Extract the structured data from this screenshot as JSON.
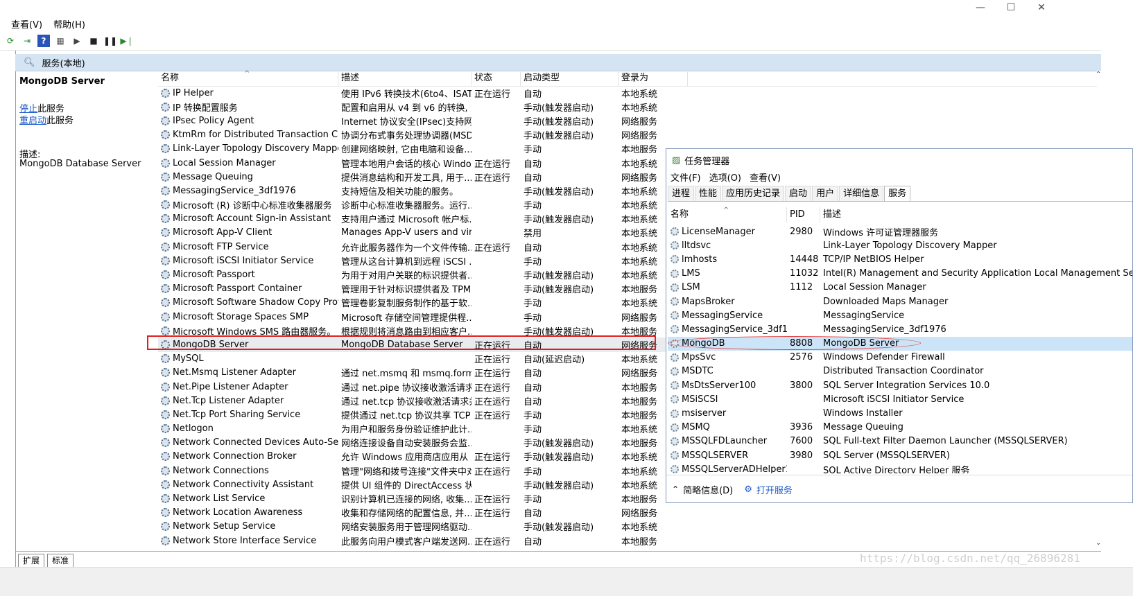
{
  "menu": {
    "view": "查看(V)",
    "help": "帮助(H)"
  },
  "window_controls": {
    "minimize": "—",
    "maximize": "☐",
    "close": "✕"
  },
  "panel": {
    "title": "服务(本地)"
  },
  "detail": {
    "service_name": "MongoDB Server",
    "stop_link": "停止",
    "stop_suffix": "此服务",
    "restart_link": "重启动",
    "restart_suffix": "此服务",
    "desc_label": "描述:",
    "desc_text": "MongoDB Database Server"
  },
  "columns": {
    "name": "名称",
    "description": "描述",
    "status": "状态",
    "startup": "启动类型",
    "logon": "登录为"
  },
  "services": [
    {
      "name": "IP Helper",
      "desc": "使用 IPv6 转换技术(6to4、ISAT...",
      "status": "正在运行",
      "startup": "自动",
      "logon": "本地系统"
    },
    {
      "name": "IP 转换配置服务",
      "desc": "配置和启用从 v4 到 v6 的转换, ...",
      "status": "",
      "startup": "手动(触发器启动)",
      "logon": "本地系统"
    },
    {
      "name": "IPsec Policy Agent",
      "desc": "Internet 协议安全(IPsec)支持网...",
      "status": "",
      "startup": "手动(触发器启动)",
      "logon": "网络服务"
    },
    {
      "name": "KtmRm for Distributed Transaction Coor...",
      "desc": "协调分布式事务处理协调器(MSD...",
      "status": "",
      "startup": "手动(触发器启动)",
      "logon": "网络服务"
    },
    {
      "name": "Link-Layer Topology Discovery Mapper",
      "desc": "创建网络映射, 它由电脑和设备...",
      "status": "",
      "startup": "手动",
      "logon": "本地服务"
    },
    {
      "name": "Local Session Manager",
      "desc": "管理本地用户会话的核心 Windo...",
      "status": "正在运行",
      "startup": "自动",
      "logon": "本地系统"
    },
    {
      "name": "Message Queuing",
      "desc": "提供消息结构和开发工具, 用于...",
      "status": "正在运行",
      "startup": "自动",
      "logon": "网络服务"
    },
    {
      "name": "MessagingService_3df1976",
      "desc": "支持短信及相关功能的服务。",
      "status": "",
      "startup": "手动(触发器启动)",
      "logon": "本地系统"
    },
    {
      "name": "Microsoft (R) 诊断中心标准收集器服务",
      "desc": "诊断中心标准收集器服务。运行...",
      "status": "",
      "startup": "手动",
      "logon": "本地系统"
    },
    {
      "name": "Microsoft Account Sign-in Assistant",
      "desc": "支持用户通过 Microsoft 帐户标...",
      "status": "",
      "startup": "手动(触发器启动)",
      "logon": "本地系统"
    },
    {
      "name": "Microsoft App-V Client",
      "desc": "Manages App-V users and virt...",
      "status": "",
      "startup": "禁用",
      "logon": "本地系统"
    },
    {
      "name": "Microsoft FTP Service",
      "desc": "允许此服务器作为一个文件传输...",
      "status": "正在运行",
      "startup": "自动",
      "logon": "本地系统"
    },
    {
      "name": "Microsoft iSCSI Initiator Service",
      "desc": "管理从这台计算机到远程 iSCSI ...",
      "status": "",
      "startup": "手动",
      "logon": "本地系统"
    },
    {
      "name": "Microsoft Passport",
      "desc": "为用于对用户关联的标识提供者...",
      "status": "",
      "startup": "手动(触发器启动)",
      "logon": "本地系统"
    },
    {
      "name": "Microsoft Passport Container",
      "desc": "管理用于针对标识提供者及 TPM ...",
      "status": "",
      "startup": "手动(触发器启动)",
      "logon": "本地服务"
    },
    {
      "name": "Microsoft Software Shadow Copy Provid...",
      "desc": "管理卷影复制服务制作的基于软...",
      "status": "",
      "startup": "手动",
      "logon": "本地系统"
    },
    {
      "name": "Microsoft Storage Spaces SMP",
      "desc": "Microsoft 存储空间管理提供程...",
      "status": "",
      "startup": "手动",
      "logon": "网络服务"
    },
    {
      "name": "Microsoft Windows SMS 路由器服务。",
      "desc": "根据规则将消息路由到相应客户...",
      "status": "",
      "startup": "手动(触发器启动)",
      "logon": "本地服务"
    },
    {
      "name": "MongoDB Server",
      "desc": "MongoDB Database Server",
      "status": "正在运行",
      "startup": "自动",
      "logon": "网络服务",
      "selected": true
    },
    {
      "name": "MySQL",
      "desc": "",
      "status": "正在运行",
      "startup": "自动(延迟启动)",
      "logon": "本地系统"
    },
    {
      "name": "Net.Msmq Listener Adapter",
      "desc": "通过 net.msmq 和 msmq.forma...",
      "status": "正在运行",
      "startup": "自动",
      "logon": "网络服务"
    },
    {
      "name": "Net.Pipe Listener Adapter",
      "desc": "通过 net.pipe 协议接收激活请求...",
      "status": "正在运行",
      "startup": "自动",
      "logon": "本地服务"
    },
    {
      "name": "Net.Tcp Listener Adapter",
      "desc": "通过 net.tcp 协议接收激活请求并...",
      "status": "正在运行",
      "startup": "自动",
      "logon": "本地服务"
    },
    {
      "name": "Net.Tcp Port Sharing Service",
      "desc": "提供通过 net.tcp 协议共享 TCP ...",
      "status": "正在运行",
      "startup": "手动",
      "logon": "本地服务"
    },
    {
      "name": "Netlogon",
      "desc": "为用户和服务身份验证维护此计...",
      "status": "",
      "startup": "手动",
      "logon": "本地系统"
    },
    {
      "name": "Network Connected Devices Auto-Setup",
      "desc": "网络连接设备自动安装服务会监...",
      "status": "",
      "startup": "手动(触发器启动)",
      "logon": "本地服务"
    },
    {
      "name": "Network Connection Broker",
      "desc": "允许 Windows 应用商店应用从 I...",
      "status": "正在运行",
      "startup": "手动(触发器启动)",
      "logon": "本地系统"
    },
    {
      "name": "Network Connections",
      "desc": "管理\"网络和拨号连接\"文件夹中对...",
      "status": "正在运行",
      "startup": "手动",
      "logon": "本地系统"
    },
    {
      "name": "Network Connectivity Assistant",
      "desc": "提供 UI 组件的 DirectAccess 状...",
      "status": "",
      "startup": "手动(触发器启动)",
      "logon": "本地系统"
    },
    {
      "name": "Network List Service",
      "desc": "识别计算机已连接的网络, 收集...",
      "status": "正在运行",
      "startup": "手动",
      "logon": "本地服务"
    },
    {
      "name": "Network Location Awareness",
      "desc": "收集和存储网络的配置信息, 并...",
      "status": "正在运行",
      "startup": "自动",
      "logon": "网络服务"
    },
    {
      "name": "Network Setup Service",
      "desc": "网络安装服务用于管理网络驱动...",
      "status": "",
      "startup": "手动(触发器启动)",
      "logon": "本地系统"
    },
    {
      "name": "Network Store Interface Service",
      "desc": "此服务向用户模式客户端发送网...",
      "status": "正在运行",
      "startup": "自动",
      "logon": "本地服务"
    }
  ],
  "bottom_tabs": {
    "extended": "扩展",
    "standard": "标准"
  },
  "task_manager": {
    "title": "任务管理器",
    "menu": {
      "file": "文件(F)",
      "options": "选项(O)",
      "view": "查看(V)"
    },
    "tabs": [
      "进程",
      "性能",
      "应用历史记录",
      "启动",
      "用户",
      "详细信息",
      "服务"
    ],
    "active_tab": "服务",
    "columns": {
      "name": "名称",
      "pid": "PID",
      "description": "描述"
    },
    "rows": [
      {
        "name": "LicenseManager",
        "pid": "2980",
        "desc": "Windows 许可证管理器服务"
      },
      {
        "name": "lltdsvc",
        "pid": "",
        "desc": "Link-Layer Topology Discovery Mapper"
      },
      {
        "name": "lmhosts",
        "pid": "14448",
        "desc": "TCP/IP NetBIOS Helper"
      },
      {
        "name": "LMS",
        "pid": "11032",
        "desc": "Intel(R) Management and Security Application Local Management Se"
      },
      {
        "name": "LSM",
        "pid": "1112",
        "desc": "Local Session Manager"
      },
      {
        "name": "MapsBroker",
        "pid": "",
        "desc": "Downloaded Maps Manager"
      },
      {
        "name": "MessagingService",
        "pid": "",
        "desc": "MessagingService"
      },
      {
        "name": "MessagingService_3df19...",
        "pid": "",
        "desc": "MessagingService_3df1976"
      },
      {
        "name": "MongoDB",
        "pid": "8808",
        "desc": "MongoDB Server",
        "selected": true
      },
      {
        "name": "MpsSvc",
        "pid": "2576",
        "desc": "Windows Defender Firewall"
      },
      {
        "name": "MSDTC",
        "pid": "",
        "desc": "Distributed Transaction Coordinator"
      },
      {
        "name": "MsDtsServer100",
        "pid": "3800",
        "desc": "SQL Server Integration Services 10.0"
      },
      {
        "name": "MSiSCSI",
        "pid": "",
        "desc": "Microsoft iSCSI Initiator Service"
      },
      {
        "name": "msiserver",
        "pid": "",
        "desc": "Windows Installer"
      },
      {
        "name": "MSMQ",
        "pid": "3936",
        "desc": "Message Queuing"
      },
      {
        "name": "MSSQLFDLauncher",
        "pid": "7600",
        "desc": "SQL Full-text Filter Daemon Launcher (MSSQLSERVER)"
      },
      {
        "name": "MSSQLSERVER",
        "pid": "3980",
        "desc": "SQL Server (MSSQLSERVER)"
      },
      {
        "name": "MSSQLServerADHelper1...",
        "pid": "",
        "desc": "SQL Active Directory Helper 服务"
      }
    ],
    "footer": {
      "brief": "简略信息(D)",
      "open_services": "打开服务"
    }
  },
  "watermark": "https://blog.csdn.net/qq_26896281",
  "colors": {
    "selection_highlight": "#e02020",
    "link": "#1a57c7",
    "panel_header": "#d5e4f3",
    "tm_selected_row": "#cce4f7"
  }
}
